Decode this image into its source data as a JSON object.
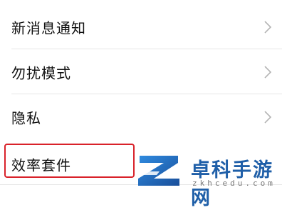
{
  "settings": {
    "items": [
      {
        "label": "新消息通知",
        "icon": "chevron-right-icon"
      },
      {
        "label": "勿扰模式",
        "icon": "chevron-right-icon"
      },
      {
        "label": "隐私",
        "icon": "chevron-right-icon"
      },
      {
        "label": "效率套件"
      }
    ]
  },
  "highlight_color": "#d9222a",
  "watermark": {
    "title": "卓科手游网",
    "subtitle": "zkhcedu.com",
    "color": "#1f5fa8"
  }
}
